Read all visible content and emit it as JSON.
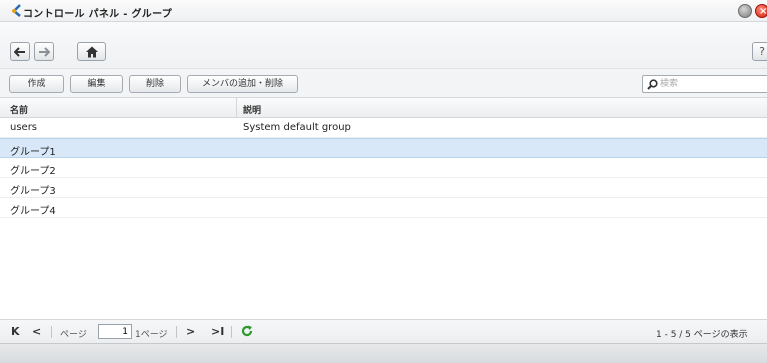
{
  "window": {
    "title": "コントロール パネル - グループ",
    "help_label": "?"
  },
  "toolbar": {
    "create_label": "作成",
    "edit_label": "編集",
    "delete_label": "削除",
    "members_label": "メンバの追加・削除",
    "search_placeholder": "検索"
  },
  "grid": {
    "columns": [
      "名前",
      "説明"
    ],
    "rows": [
      {
        "name": "users",
        "description": "System default group",
        "selected": false
      },
      {
        "name": "グループ1",
        "description": "",
        "selected": true
      },
      {
        "name": "グループ2",
        "description": "",
        "selected": false
      },
      {
        "name": "グループ3",
        "description": "",
        "selected": false
      },
      {
        "name": "グループ4",
        "description": "",
        "selected": false
      }
    ]
  },
  "pager": {
    "page_label": "ページ",
    "current_page": "1",
    "total_pages_label": "1ページ",
    "info": "1 - 5 / 5 ページの表示"
  },
  "icons": {
    "app": "control-panel-icon",
    "back": "back-arrow-icon",
    "forward": "forward-arrow-icon",
    "home": "home-icon",
    "search": "search-icon",
    "first": "first-page-icon",
    "prev": "prev-page-icon",
    "next": "next-page-icon",
    "last": "last-page-icon",
    "refresh": "refresh-icon"
  },
  "colors": {
    "selected_row": "#d8e8f8",
    "refresh": "#2e9a2e",
    "close": "#d21d0a"
  }
}
